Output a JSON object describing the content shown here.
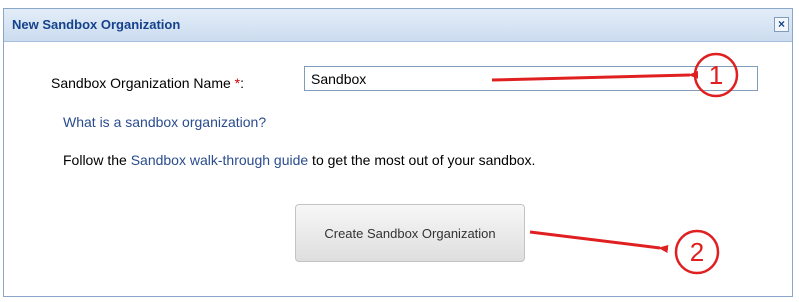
{
  "dialog": {
    "title": "New Sandbox Organization",
    "close_glyph": "×"
  },
  "form": {
    "name_label": "Sandbox Organization Name",
    "required_marker": "*",
    "label_colon": ":",
    "name_value": "Sandbox"
  },
  "links": {
    "what_is": "What is a sandbox organization?",
    "follow_prefix": "Follow the ",
    "guide_link": "Sandbox walk-through guide",
    "follow_suffix": " to get the most out of your sandbox."
  },
  "actions": {
    "create_label": "Create Sandbox Organization"
  },
  "annotations": {
    "callout_1": "1",
    "callout_2": "2",
    "color": "#e02020"
  },
  "colors": {
    "title_text": "#15428b",
    "link": "#2a4c8d",
    "required": "#cc0000"
  }
}
